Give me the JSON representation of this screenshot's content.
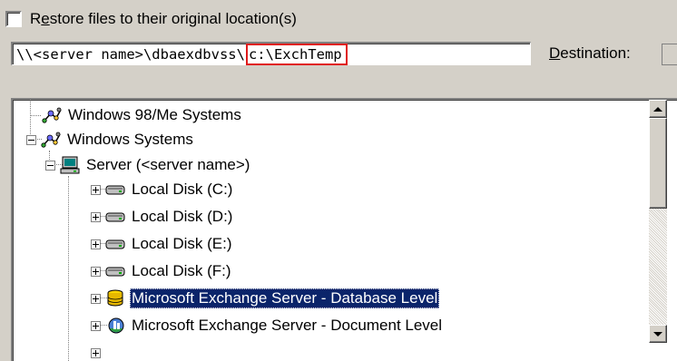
{
  "restore_option": {
    "label_prefix": "R",
    "label_accel": "e",
    "label_rest": "store files to their original location(s)",
    "checked": false
  },
  "path": {
    "prefix": "\\\\<server name>\\dbaexdbvss\\",
    "highlighted": "c:\\ExchTemp"
  },
  "destination": {
    "label_accel": "D",
    "label_rest": "estination:"
  },
  "tree": {
    "items": [
      {
        "label": "Windows 98/Me Systems",
        "icon": "network-icon"
      },
      {
        "label": "Windows Systems",
        "icon": "network-icon",
        "expanded": true
      },
      {
        "label": "Server (<server name>)",
        "icon": "computer-icon",
        "expanded": true
      },
      {
        "label": "Local Disk (C:)",
        "icon": "drive-icon"
      },
      {
        "label": "Local Disk (D:)",
        "icon": "drive-icon"
      },
      {
        "label": "Local Disk (E:)",
        "icon": "drive-icon"
      },
      {
        "label": "Local Disk (F:)",
        "icon": "drive-icon"
      },
      {
        "label": "Microsoft Exchange Server - Database Level",
        "icon": "database-icon",
        "selected": true
      },
      {
        "label": "Microsoft Exchange Server - Document Level",
        "icon": "exchange-icon"
      }
    ]
  },
  "colors": {
    "selection": "#0a246a",
    "highlight_border": "#e01b1b",
    "window_bg": "#d4d0c8"
  }
}
